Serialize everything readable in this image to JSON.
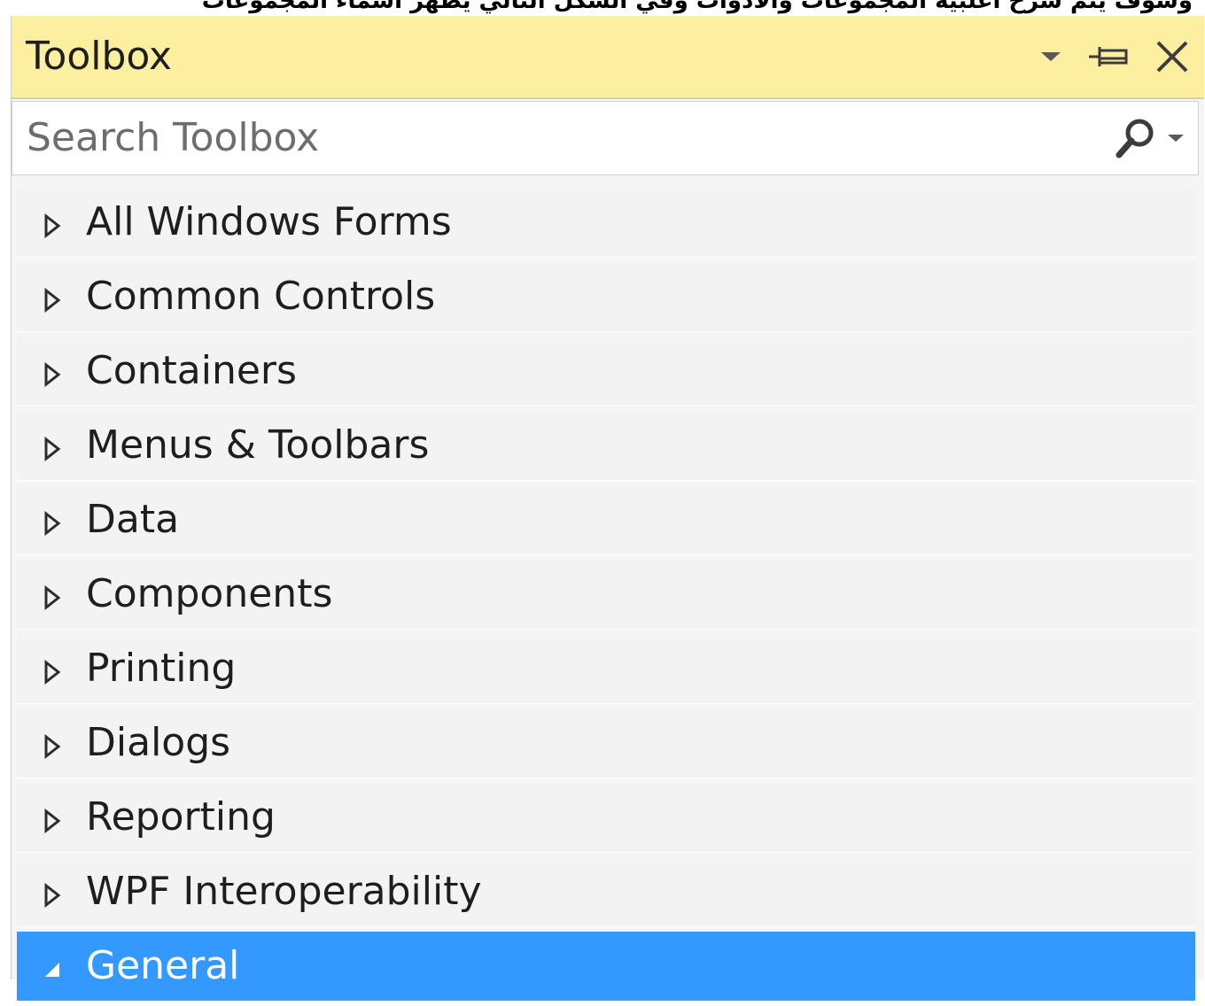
{
  "top_caption": "وسوف يتم شرح أغلبية المجموعات والأدوات وفي الشكل التالي يظهر أسماء المجموعات",
  "toolbox": {
    "title": "Toolbox",
    "icons": [
      "dropdown-arrow-icon",
      "pin-icon",
      "close-icon"
    ],
    "search_placeholder": "Search Toolbox",
    "search_icons": [
      "search-icon",
      "search-options-dropdown-icon"
    ],
    "groups": [
      {
        "label": "All Windows Forms",
        "expanded": false
      },
      {
        "label": "Common Controls",
        "expanded": false
      },
      {
        "label": "Containers",
        "expanded": false
      },
      {
        "label": "Menus & Toolbars",
        "expanded": false
      },
      {
        "label": "Data",
        "expanded": false
      },
      {
        "label": "Components",
        "expanded": false
      },
      {
        "label": "Printing",
        "expanded": false
      },
      {
        "label": "Dialogs",
        "expanded": false
      },
      {
        "label": "Reporting",
        "expanded": false
      },
      {
        "label": "WPF Interoperability",
        "expanded": false
      },
      {
        "label": "General",
        "expanded": true,
        "selected": true
      }
    ]
  },
  "colors": {
    "titlebar_bg": "#fcf0a0",
    "selected_bg": "#3399ff",
    "row_bg": "#f3f3f3"
  }
}
